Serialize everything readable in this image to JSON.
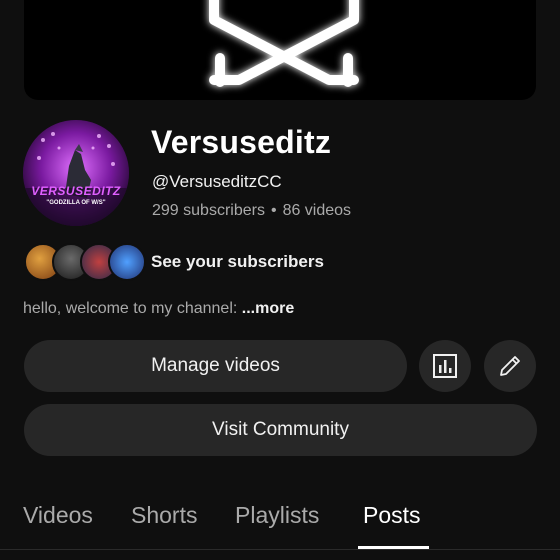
{
  "channel": {
    "name": "Versuseditz",
    "handle": "@VersuseditzCC",
    "subscribers": "299 subscribers",
    "separator": "•",
    "videos": "86 videos",
    "avatar_text": "VERSUSEDITZ",
    "avatar_subtext": "\"GODZILLA OF W/S\""
  },
  "subscribers_row": {
    "label": "See your subscribers"
  },
  "description": {
    "text": "hello, welcome to my channel: ",
    "more": "...more"
  },
  "actions": {
    "manage_videos": "Manage videos",
    "analytics_icon": "analytics-icon",
    "edit_icon": "pencil-icon",
    "visit_community": "Visit Community"
  },
  "tabs": [
    {
      "label": "Videos",
      "active": false
    },
    {
      "label": "Shorts",
      "active": false
    },
    {
      "label": "Playlists",
      "active": false
    },
    {
      "label": "Posts",
      "active": true
    }
  ],
  "colors": {
    "background": "#0f0f0f",
    "button": "#272727",
    "secondary_text": "#aaaaaa",
    "avatar_accent": "#c040e0"
  }
}
